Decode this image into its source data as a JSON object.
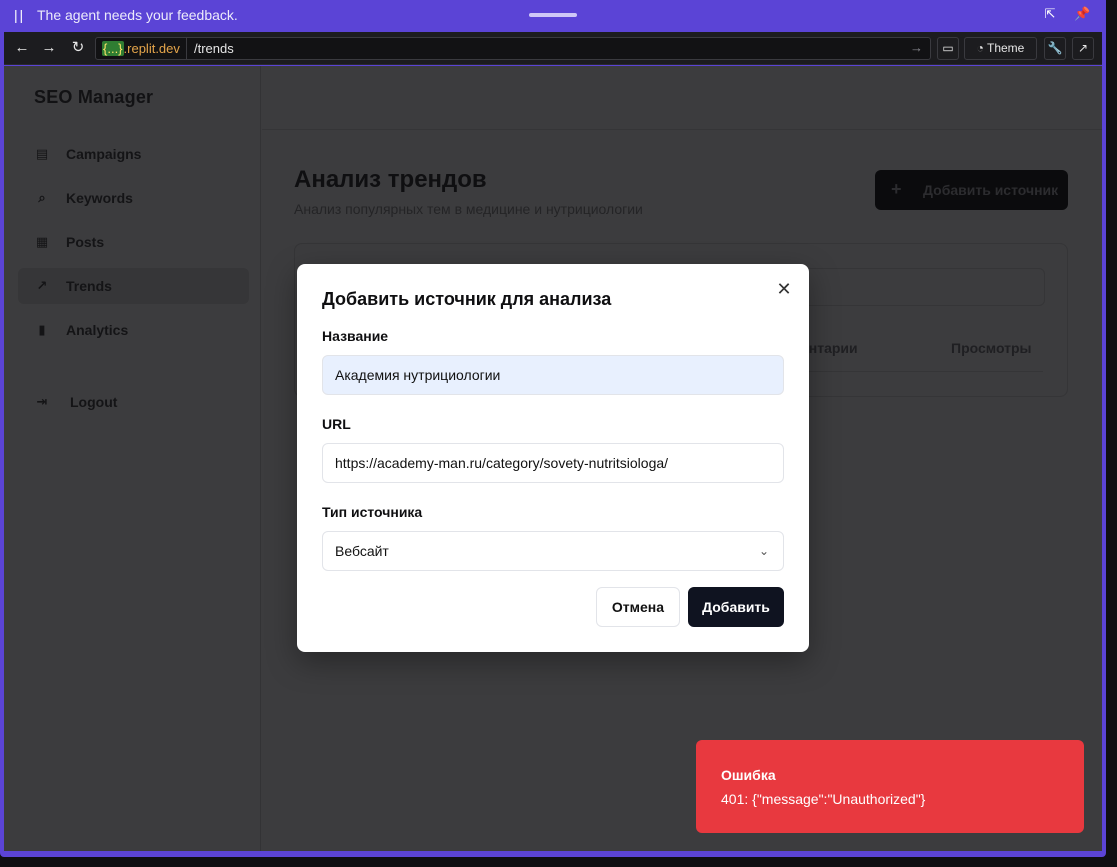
{
  "topbar": {
    "message": "The agent needs your feedback."
  },
  "browser": {
    "host_brace": "{...}",
    "host_domain": ".replit.dev",
    "path": "/trends",
    "theme_label": "Theme"
  },
  "sidebar": {
    "brand": "SEO Manager",
    "items": [
      {
        "label": "Campaigns",
        "icon": "file-text-icon"
      },
      {
        "label": "Keywords",
        "icon": "search-icon"
      },
      {
        "label": "Posts",
        "icon": "calendar-icon"
      },
      {
        "label": "Trends",
        "icon": "trending-up-icon",
        "active": true
      },
      {
        "label": "Analytics",
        "icon": "bar-chart-icon"
      }
    ],
    "logout": "Logout"
  },
  "page": {
    "title": "Анализ трендов",
    "subtitle": "Анализ популярных тем в медицине и нутрициологии",
    "add_source_button": "Добавить источник",
    "table_headers": [
      "ентарии",
      "Просмотры"
    ]
  },
  "modal": {
    "title": "Добавить источник для анализа",
    "name_label": "Название",
    "name_value": "Академия нутрициологии",
    "url_label": "URL",
    "url_value": "https://academy-man.ru/category/sovety-nutritsiologa/",
    "type_label": "Тип источника",
    "type_value": "Вебсайт",
    "cancel_label": "Отмена",
    "submit_label": "Добавить"
  },
  "toast": {
    "title": "Ошибка",
    "message": "401: {\"message\":\"Unauthorized\"}"
  },
  "colors": {
    "frame": "#5b44d6",
    "toast_bg": "#e8393f",
    "submit_bg": "#0f1320",
    "filled_input_bg": "#e8f0fe"
  }
}
